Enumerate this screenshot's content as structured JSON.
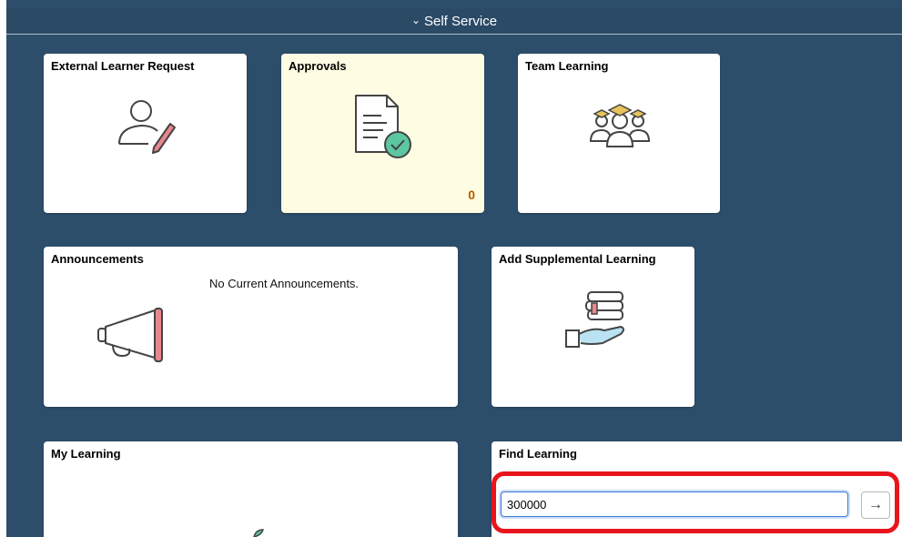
{
  "header": {
    "title": "Self Service",
    "chevron_icon": "chevron-down-icon"
  },
  "tiles": {
    "external_learner_request": {
      "title": "External Learner Request",
      "icon": "person-pencil-icon"
    },
    "approvals": {
      "title": "Approvals",
      "icon": "document-check-icon",
      "count": "0",
      "bg": "#fefde3"
    },
    "team_learning": {
      "title": "Team Learning",
      "icon": "graduates-team-icon"
    },
    "announcements": {
      "title": "Announcements",
      "message": "No Current Announcements.",
      "icon": "megaphone-icon"
    },
    "add_supplemental_learning": {
      "title": "Add Supplemental Learning",
      "icon": "books-hand-icon"
    },
    "my_learning": {
      "title": "My Learning",
      "icon": "leaf-icon"
    },
    "find_learning": {
      "title": "Find Learning",
      "search_value": "300000",
      "go_icon": "arrow-right-icon"
    }
  },
  "colors": {
    "background": "#2d4e6b",
    "highlight": "#e8141c",
    "accent_pink": "#e8878d",
    "accent_teal": "#5cc7a1"
  }
}
